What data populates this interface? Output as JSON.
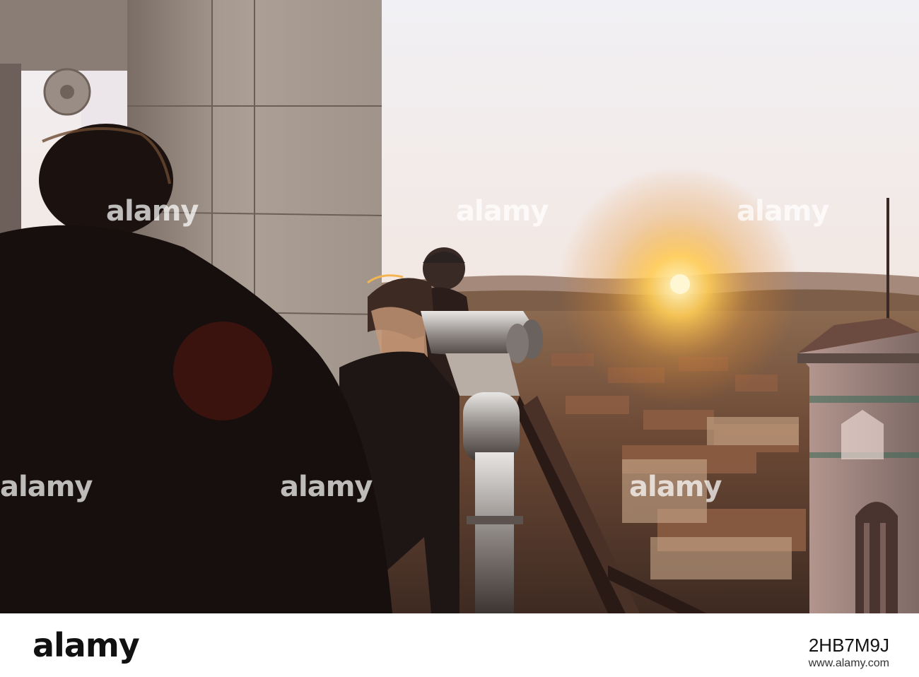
{
  "watermark": {
    "text": "alamy"
  },
  "footer": {
    "logo": "alamy",
    "image_id": "2HB7M9J",
    "url": "www.alamy.com"
  },
  "colors": {
    "sky_top": "#f1eef3",
    "sky_horizon": "#f6d9b6",
    "sun": "#fff2b0",
    "hills": "#8a6b58",
    "city": "#6e4c3a",
    "stone": "#a89a8f",
    "silhouette": "#1a1110",
    "binocular_metal": "#c9c7c6"
  }
}
